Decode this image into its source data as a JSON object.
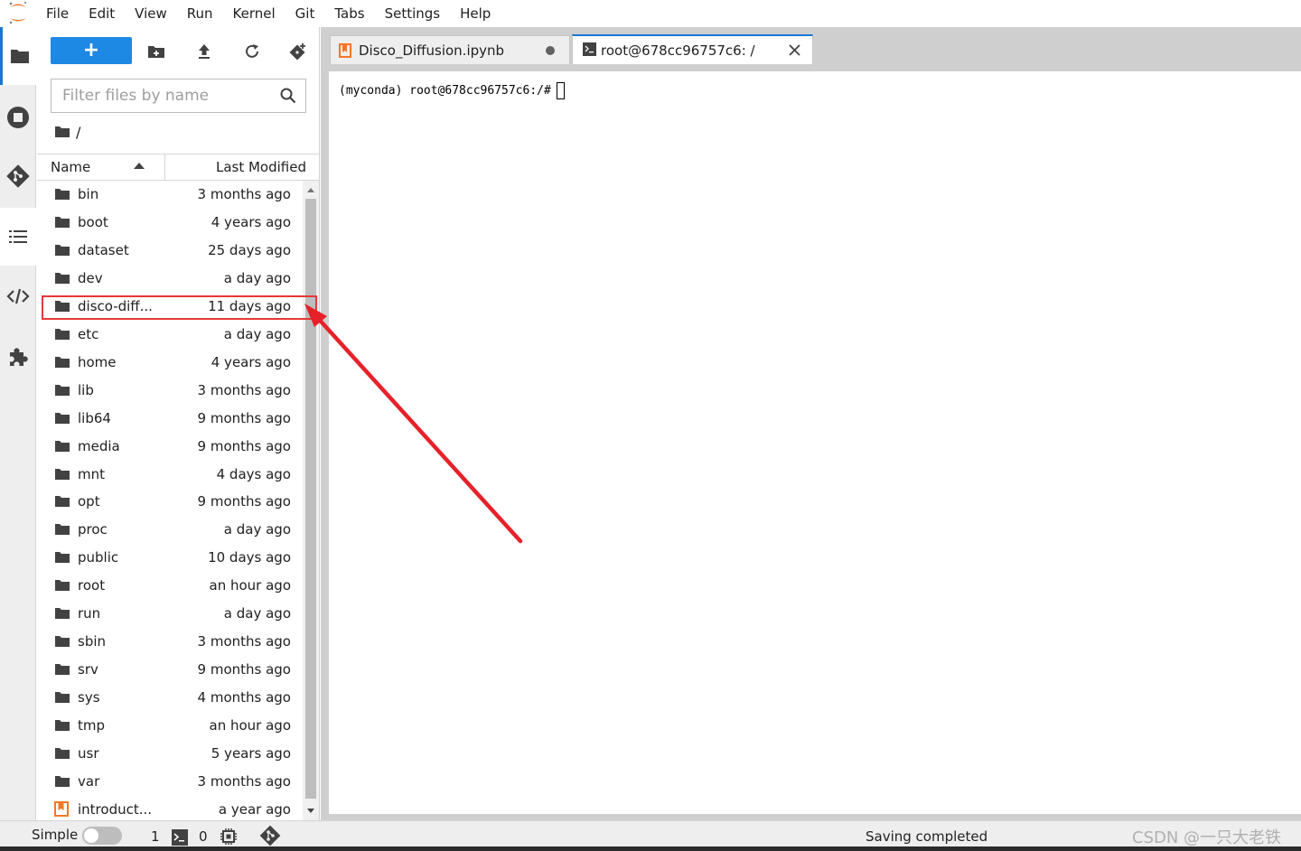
{
  "menubar": {
    "items": [
      "File",
      "Edit",
      "View",
      "Run",
      "Kernel",
      "Git",
      "Tabs",
      "Settings",
      "Help"
    ]
  },
  "filebrowser": {
    "new_button_label": "+",
    "filter_placeholder": "Filter files by name",
    "breadcrumb": "/",
    "columns": {
      "name": "Name",
      "modified": "Last Modified"
    },
    "files": [
      {
        "name": "bin",
        "modified": "3 months ago",
        "type": "folder"
      },
      {
        "name": "boot",
        "modified": "4 years ago",
        "type": "folder"
      },
      {
        "name": "dataset",
        "modified": "25 days ago",
        "type": "folder"
      },
      {
        "name": "dev",
        "modified": "a day ago",
        "type": "folder"
      },
      {
        "name": "disco-diff...",
        "modified": "11 days ago",
        "type": "folder"
      },
      {
        "name": "etc",
        "modified": "a day ago",
        "type": "folder"
      },
      {
        "name": "home",
        "modified": "4 years ago",
        "type": "folder"
      },
      {
        "name": "lib",
        "modified": "3 months ago",
        "type": "folder"
      },
      {
        "name": "lib64",
        "modified": "9 months ago",
        "type": "folder"
      },
      {
        "name": "media",
        "modified": "9 months ago",
        "type": "folder"
      },
      {
        "name": "mnt",
        "modified": "4 days ago",
        "type": "folder"
      },
      {
        "name": "opt",
        "modified": "9 months ago",
        "type": "folder"
      },
      {
        "name": "proc",
        "modified": "a day ago",
        "type": "folder"
      },
      {
        "name": "public",
        "modified": "10 days ago",
        "type": "folder"
      },
      {
        "name": "root",
        "modified": "an hour ago",
        "type": "folder"
      },
      {
        "name": "run",
        "modified": "a day ago",
        "type": "folder"
      },
      {
        "name": "sbin",
        "modified": "3 months ago",
        "type": "folder"
      },
      {
        "name": "srv",
        "modified": "9 months ago",
        "type": "folder"
      },
      {
        "name": "sys",
        "modified": "4 months ago",
        "type": "folder"
      },
      {
        "name": "tmp",
        "modified": "an hour ago",
        "type": "folder"
      },
      {
        "name": "usr",
        "modified": "5 years ago",
        "type": "folder"
      },
      {
        "name": "var",
        "modified": "3 months ago",
        "type": "folder"
      },
      {
        "name": "introduct...",
        "modified": "a year ago",
        "type": "notebook"
      }
    ]
  },
  "tabs": [
    {
      "label": "Disco_Diffusion.ipynb",
      "active": false,
      "icon": "notebook-icon",
      "unsaved": true
    },
    {
      "label": "root@678cc96757c6: /",
      "active": true,
      "icon": "terminal-icon"
    }
  ],
  "terminal": {
    "prompt": "(myconda) root@678cc96757c6:/#"
  },
  "statusbar": {
    "simple_label": "Simple",
    "terminals_count": "1",
    "kernels_count": "0",
    "status_text": "Saving completed",
    "watermark": "CSDN @一只大老铁"
  },
  "colors": {
    "accent": "#1e88e5",
    "highlight_box": "#e5393a",
    "annotation_arrow": "#e5222a",
    "notebook_orange": "#f37726"
  }
}
